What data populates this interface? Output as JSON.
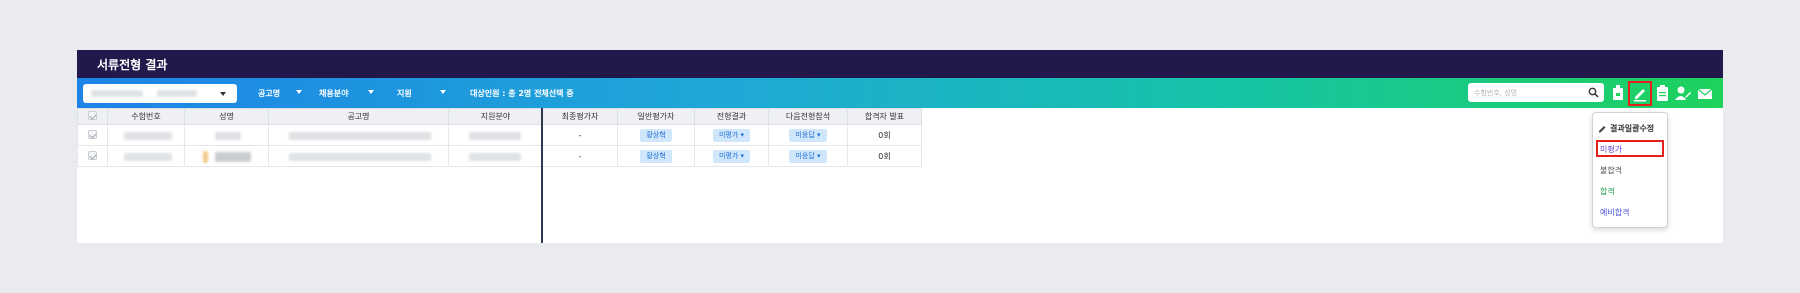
{
  "page": {
    "title": "서류전형 결과"
  },
  "toolbar": {
    "filters": [
      {
        "label": "공고명"
      },
      {
        "label": "채용분야"
      },
      {
        "label": "지원"
      }
    ],
    "target_info": "대상인원 : 총 2명  전체선택 중",
    "search_placeholder": "수험번호, 성명",
    "icons": [
      "document-icon",
      "pencil-edit-icon",
      "clipboard-icon",
      "user-edit-icon",
      "mail-icon"
    ]
  },
  "grid": {
    "columns": [
      "수험번호",
      "성명",
      "공고명",
      "지원분야",
      "최종평가자",
      "일반평가자",
      "전형결과",
      "다음전형참석",
      "합격자 발표"
    ],
    "rows": [
      {
        "final_evaluator": "-",
        "general_evaluator": "황상혁",
        "result": "미평가 ▾",
        "next_stage": "미응답 ▾",
        "announcement": "0회"
      },
      {
        "final_evaluator": "-",
        "general_evaluator": "황상혁",
        "result": "미평가 ▾",
        "next_stage": "미응답 ▾",
        "announcement": "0회"
      }
    ]
  },
  "bulk_menu": {
    "header": "결과일괄수정",
    "items": [
      {
        "label": "미평가",
        "color": "#6b3fcf"
      },
      {
        "label": "불합격",
        "color": "#555555"
      },
      {
        "label": "합격",
        "color": "#1f9e4b"
      },
      {
        "label": "예비합격",
        "color": "#4a53d6"
      }
    ]
  },
  "colors": {
    "titlebar": "#23184c",
    "highlight": "#e3201c",
    "chip": "#cfe6fb"
  }
}
